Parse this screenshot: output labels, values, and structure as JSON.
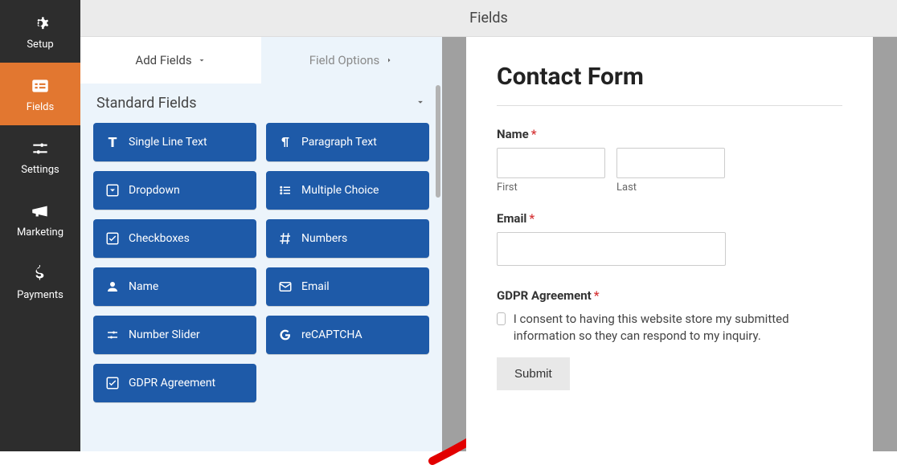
{
  "topbar": {
    "title": "Fields"
  },
  "sidebar": {
    "items": [
      {
        "label": "Setup"
      },
      {
        "label": "Fields"
      },
      {
        "label": "Settings"
      },
      {
        "label": "Marketing"
      },
      {
        "label": "Payments"
      }
    ]
  },
  "panel": {
    "tabs": {
      "add": "Add Fields",
      "options": "Field Options"
    },
    "section_title": "Standard Fields",
    "fields": [
      {
        "label": "Single Line Text"
      },
      {
        "label": "Paragraph Text"
      },
      {
        "label": "Dropdown"
      },
      {
        "label": "Multiple Choice"
      },
      {
        "label": "Checkboxes"
      },
      {
        "label": "Numbers"
      },
      {
        "label": "Name"
      },
      {
        "label": "Email"
      },
      {
        "label": "Number Slider"
      },
      {
        "label": "reCAPTCHA"
      },
      {
        "label": "GDPR Agreement"
      }
    ]
  },
  "preview": {
    "title": "Contact Form",
    "name_label": "Name",
    "first": "First",
    "last": "Last",
    "email_label": "Email",
    "gdpr_label": "GDPR Agreement",
    "gdpr_text": "I consent to having this website store my submitted information so they can respond to my inquiry.",
    "submit": "Submit",
    "required_marker": "*"
  }
}
